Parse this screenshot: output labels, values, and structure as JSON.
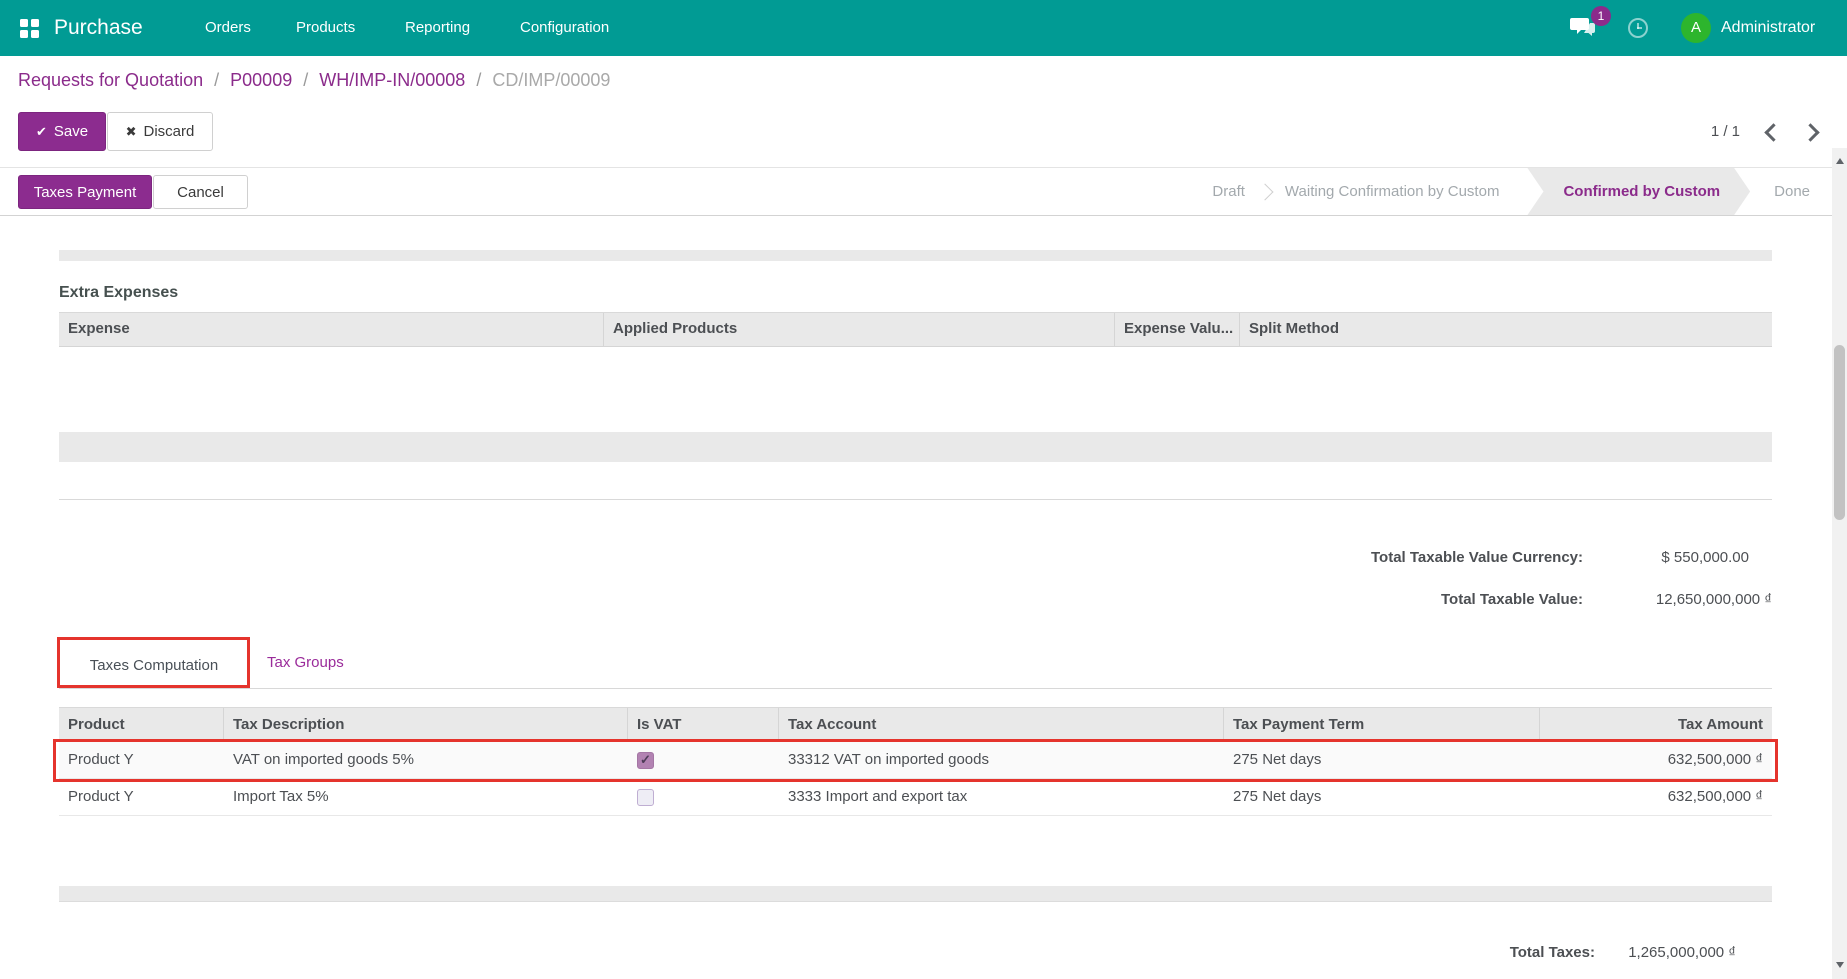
{
  "colors": {
    "navbar_teal": "#019b94",
    "accent_purple": "#8b2b8b",
    "annotation_red": "#e5342d",
    "avatar_green": "#2db52d",
    "table_header_bg": "#e9e9e9",
    "inactive_step_gray": "#a3a9ad",
    "scrollbar_thumb": "#c2c2c2"
  },
  "navbar": {
    "app_name": "Purchase",
    "menus": [
      "Orders",
      "Products",
      "Reporting",
      "Configuration"
    ],
    "message_badge": "1",
    "user_initial": "A",
    "user_name": "Administrator"
  },
  "breadcrumb": {
    "links": [
      "Requests for Quotation",
      "P00009",
      "WH/IMP-IN/00008"
    ],
    "current": "CD/IMP/00009",
    "separator": "/"
  },
  "toolbar": {
    "save_label": "Save",
    "save_icon": "✔",
    "discard_label": "Discard",
    "discard_icon": "✖",
    "pager": "1 / 1"
  },
  "statusbar": {
    "action_primary": "Taxes Payment",
    "action_secondary": "Cancel",
    "steps": [
      {
        "label": "Draft",
        "css": "step"
      },
      {
        "label": "Waiting Confirmation by Custom",
        "css": "step"
      },
      {
        "label": "Confirmed by Custom",
        "css": "step active"
      },
      {
        "label": "Done",
        "css": "step step-done"
      }
    ]
  },
  "extra_expenses": {
    "title": "Extra Expenses",
    "columns": [
      "Expense",
      "Applied Products",
      "Expense Valu...",
      "Split Method"
    ]
  },
  "totals": {
    "rows": [
      {
        "label": "Total Taxable Value Currency:",
        "value": "$ 550,000.00"
      },
      {
        "label": "Total Taxable Value:",
        "value": "12,650,000,000 ₫"
      }
    ],
    "total_taxes": {
      "label": "Total Taxes:",
      "value": "1,265,000,000 ₫"
    }
  },
  "tabs": {
    "active": "Taxes Computation",
    "inactive": "Tax Groups"
  },
  "taxes_table": {
    "columns": [
      "Product",
      "Tax Description",
      "Is VAT",
      "Tax Account",
      "Tax Payment Term",
      "Tax Amount"
    ],
    "rows": [
      {
        "product": "Product Y",
        "tax_description": "VAT on imported goods 5%",
        "is_vat_checked": "true",
        "checkbox_class": "cb checked",
        "tax_account": "33312 VAT on imported goods",
        "tax_payment_term": "275 Net days",
        "tax_amount": "632,500,000 ₫"
      },
      {
        "product": "Product Y",
        "tax_description": "Import Tax 5%",
        "is_vat_checked": "false",
        "checkbox_class": "cb un",
        "tax_account": "3333 Import and export tax",
        "tax_payment_term": "275 Net days",
        "tax_amount": "632,500,000 ₫"
      }
    ]
  }
}
